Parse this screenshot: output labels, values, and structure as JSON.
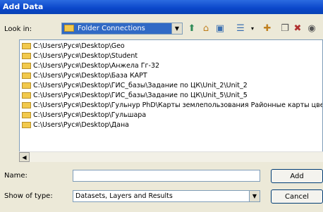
{
  "window": {
    "title": "Add Data"
  },
  "lookin": {
    "label": "Look in:",
    "value": "Folder Connections"
  },
  "toolbar": {
    "icons": [
      "up-one-level-icon",
      "home-icon",
      "connect-folder-icon",
      "view-menu-icon",
      "new-folder-icon",
      "copy-icon",
      "delete-icon",
      "catalog-icon"
    ]
  },
  "folders": [
    "C:\\Users\\Руся\\Desktop\\Geo",
    "C:\\Users\\Руся\\Desktop\\Student",
    "C:\\Users\\Руся\\Desktop\\Анжела Гг-32",
    "C:\\Users\\Руся\\Desktop\\База КАРТ",
    "C:\\Users\\Руся\\Desktop\\ГИС_базы\\Задание по ЦК\\Unit_2\\Unit_2",
    "C:\\Users\\Руся\\Desktop\\ГИС_базы\\Задание по ЦК\\Unit_5\\Unit_5",
    "C:\\Users\\Руся\\Desktop\\Гульнур PhD\\Карты землепользования Районные карты цветные",
    "C:\\Users\\Руся\\Desktop\\Гульшара",
    "C:\\Users\\Руся\\Desktop\\Дана"
  ],
  "form": {
    "name_label": "Name:",
    "name_value": "",
    "type_label": "Show of type:",
    "type_value": "Datasets, Layers and Results"
  },
  "buttons": {
    "add": "Add",
    "cancel": "Cancel"
  }
}
